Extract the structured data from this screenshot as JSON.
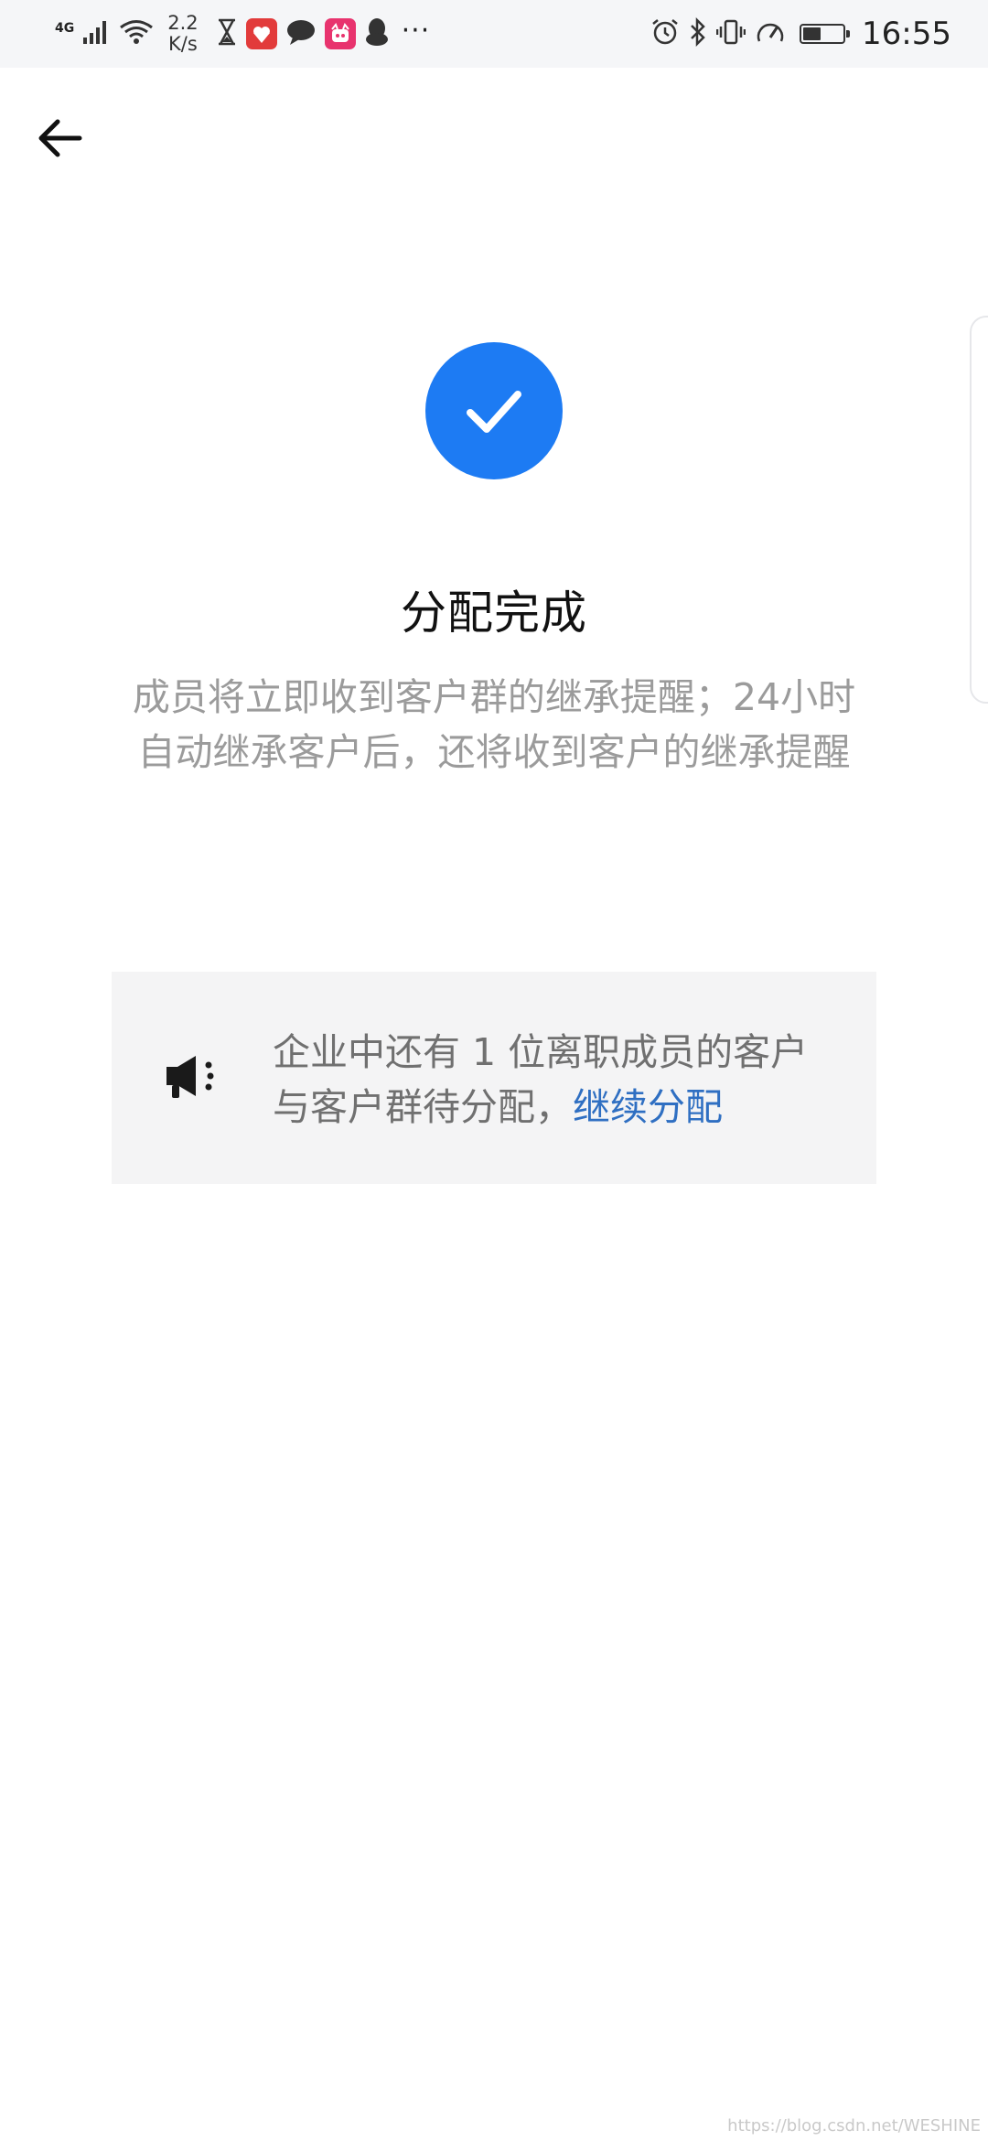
{
  "status_bar": {
    "network": "4G",
    "speed_value": "2.2",
    "speed_unit": "K/s",
    "more": "···",
    "time": "16:55",
    "battery_level": 0.45
  },
  "page": {
    "title": "分配完成",
    "description": "成员将立即收到客户群的继承提醒；24小时自动继承客户后，还将收到客户的继承提醒"
  },
  "notice": {
    "text": "企业中还有 1 位离职成员的客户与客户群待分配，",
    "link": "继续分配"
  },
  "watermark": "https://blog.csdn.net/WESHINE",
  "colors": {
    "accent": "#1d7bf3",
    "link": "#2f6fc2",
    "muted_text": "#9b9b9b"
  }
}
